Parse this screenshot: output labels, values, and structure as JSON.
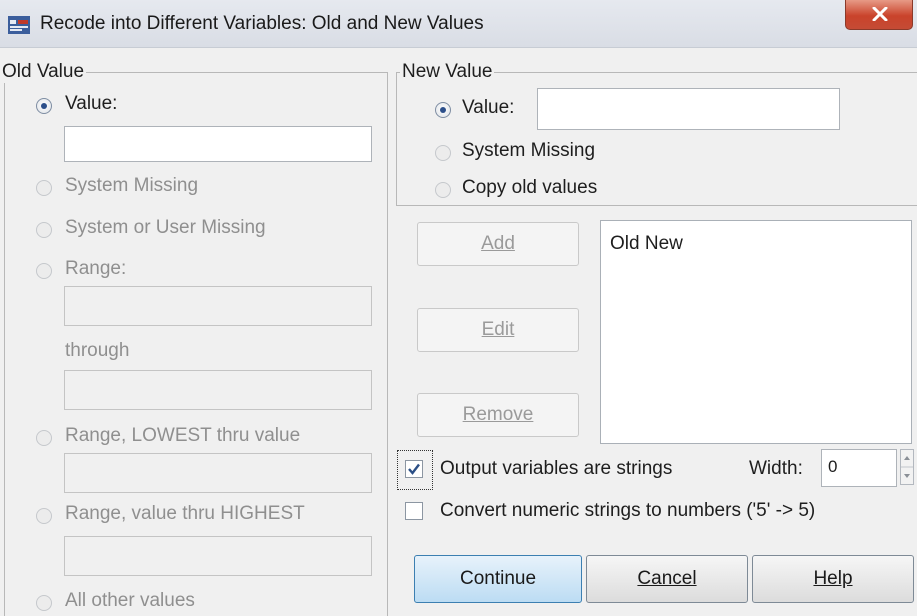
{
  "window": {
    "title": "Recode into Different Variables: Old and New Values",
    "close_glyph": "X"
  },
  "old_value": {
    "legend": "Old Value",
    "value_label": "Value:",
    "value_input": "",
    "system_missing": "System Missing",
    "system_or_user_missing": "System or User Missing",
    "range": "Range:",
    "through": "through",
    "range_lowest": "Range, LOWEST thru value",
    "range_highest": "Range, value thru HIGHEST",
    "all_other": "All other values"
  },
  "new_value": {
    "legend": "New Value",
    "value_label": "Value:",
    "value_input": "",
    "system_missing": "System Missing",
    "copy_old": "Copy old values"
  },
  "buttons": {
    "add": "Add",
    "edit": "Edit",
    "remove": "Remove",
    "continue": "Continue",
    "cancel": "Cancel",
    "help": "Help"
  },
  "list": {
    "header": "Old New"
  },
  "options": {
    "output_strings": "Output variables are strings",
    "output_strings_checked": true,
    "width_label": "Width:",
    "width_value": "0",
    "convert_numeric": "Convert numeric strings to numbers ('5' -> 5)",
    "convert_numeric_checked": false
  }
}
